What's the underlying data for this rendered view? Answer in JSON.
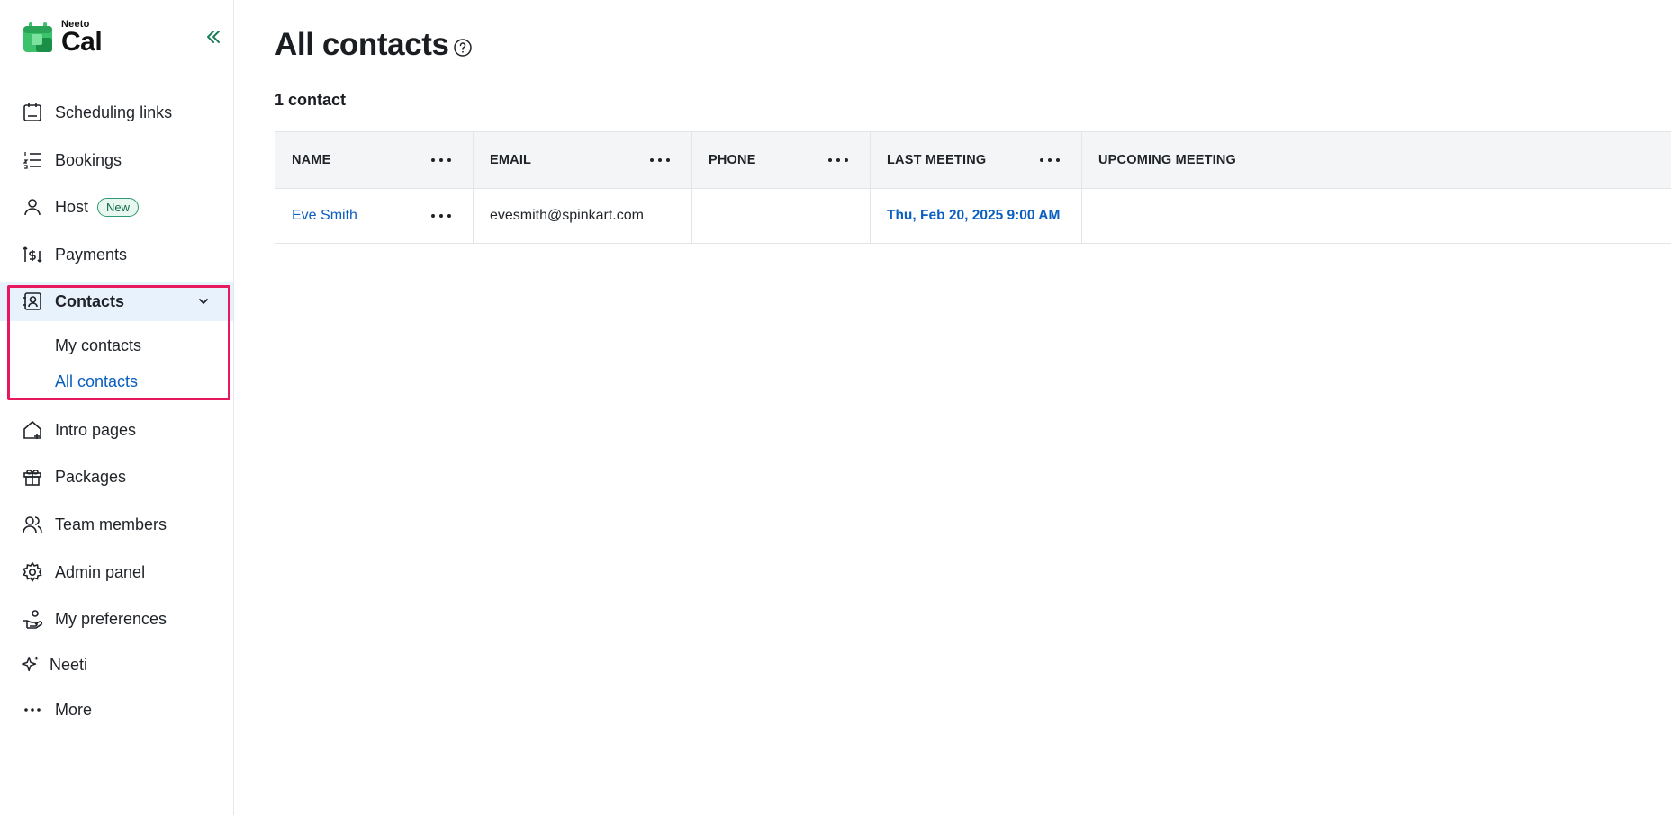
{
  "brand": {
    "top": "Neeto",
    "bottom": "Cal",
    "logo_color": "#22b35e"
  },
  "sidebar": {
    "items": [
      {
        "label": "Scheduling links",
        "icon": "calendar-icon"
      },
      {
        "label": "Bookings",
        "icon": "list-numbered-icon"
      },
      {
        "label": "Host",
        "icon": "user-icon",
        "badge": "New"
      },
      {
        "label": "Payments",
        "icon": "payments-icon"
      },
      {
        "label": "Contacts",
        "icon": "contact-book-icon",
        "active": true,
        "expanded": true
      },
      {
        "label": "Intro pages",
        "icon": "home-plus-icon"
      },
      {
        "label": "Packages",
        "icon": "gift-icon"
      },
      {
        "label": "Team members",
        "icon": "users-icon"
      },
      {
        "label": "Admin panel",
        "icon": "gear-icon"
      },
      {
        "label": "My preferences",
        "icon": "hand-gear-icon"
      },
      {
        "label": "Neeti",
        "icon": "sparkle-icon"
      },
      {
        "label": "More",
        "icon": "more-dots-icon"
      }
    ],
    "contacts_sub": [
      {
        "label": "My contacts",
        "active": false
      },
      {
        "label": "All contacts",
        "active": true
      }
    ]
  },
  "main": {
    "title": "All contacts",
    "count": "1 contact",
    "table": {
      "columns": [
        "NAME",
        "EMAIL",
        "PHONE",
        "LAST MEETING",
        "UPCOMING MEETING"
      ],
      "rows": [
        {
          "name": "Eve Smith",
          "email": "evesmith@spinkart.com",
          "phone": "",
          "last_meeting": "Thu, Feb 20, 2025 9:00 AM",
          "upcoming_meeting": ""
        }
      ]
    }
  },
  "colors": {
    "accent": "#0b5fbf",
    "active_bg": "#e8f2fd",
    "highlight": "#e8185f",
    "badge_green": "#2e9a74"
  }
}
